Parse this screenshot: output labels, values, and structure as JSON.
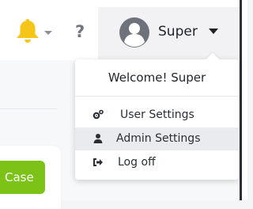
{
  "topbar": {
    "notifications_icon": "bell-icon",
    "help_label": "?",
    "user_name": "Super",
    "accent_bell": "#f5c518"
  },
  "dropdown": {
    "welcome": "Welcome! Super",
    "items": [
      {
        "label": "User Settings",
        "icon": "user-settings-icon"
      },
      {
        "label": "Admin Settings",
        "icon": "user-icon",
        "hovered": true
      },
      {
        "label": "Log off",
        "icon": "logout-icon"
      }
    ]
  },
  "content": {
    "case_button_label": "Case",
    "case_button_color": "#7cc217"
  }
}
